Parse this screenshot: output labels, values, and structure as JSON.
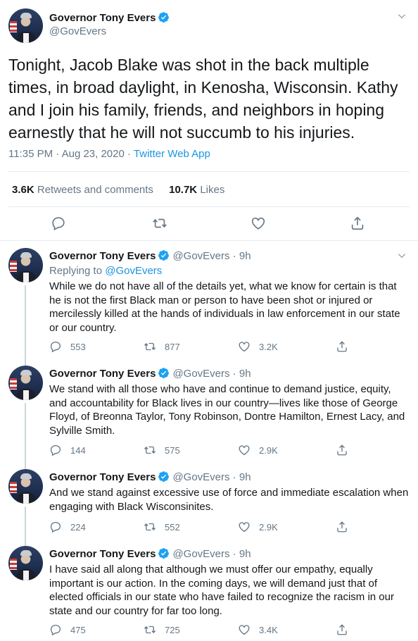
{
  "author": {
    "name": "Governor Tony Evers",
    "handle": "@GovEvers"
  },
  "main_tweet": {
    "text": "Tonight, Jacob Blake was shot in the back multiple times, in broad daylight, in Kenosha, Wisconsin. Kathy and I join his family, friends, and neighbors in hoping earnestly that he will not succumb to his injuries.",
    "time": "11:35 PM · Aug 23, 2020 · ",
    "app": "Twitter Web App",
    "retweets_count": "3.6K",
    "retweets_label": "Retweets and comments",
    "likes_count": "10.7K",
    "likes_label": "Likes"
  },
  "replies": [
    {
      "handle_time": "@GovEvers · 9h",
      "replying_to_label": "Replying to ",
      "replying_to_handle": "@GovEvers",
      "text": "While we do not have all of the details yet, what we know for certain is that he is not the first Black man or person to have been shot or injured or mercilessly killed at the hands of individuals in law enforcement in our state or our country.",
      "comments": "553",
      "retweets": "877",
      "likes": "3.2K"
    },
    {
      "handle_time": "@GovEvers · 9h",
      "text": "We stand with all those who have and continue to demand justice, equity, and accountability for Black lives in our country—lives like those of George Floyd, of Breonna Taylor, Tony Robinson, Dontre Hamilton, Ernest Lacy, and Sylville Smith.",
      "comments": "144",
      "retweets": "575",
      "likes": "2.9K"
    },
    {
      "handle_time": "@GovEvers · 9h",
      "text": "And we stand against excessive use of force and immediate escalation when engaging with Black Wisconsinites.",
      "comments": "224",
      "retweets": "552",
      "likes": "2.9K"
    },
    {
      "handle_time": "@GovEvers · 9h",
      "text": "I have said all along that although we must offer our empathy, equally important is our action. In the coming days, we will demand just that of elected officials in our state who have failed to recognize the racism in our state and our country for far too long.",
      "comments": "475",
      "retweets": "725",
      "likes": "3.4K"
    }
  ],
  "icons": [
    "comment-icon",
    "retweet-icon",
    "like-icon",
    "share-icon",
    "verified-badge-icon",
    "chevron-down-icon"
  ],
  "colors": {
    "link": "#1b95e0",
    "verified": "#1da1f2",
    "secondary_text": "#657786",
    "thread_line": "#ccd6dd"
  }
}
